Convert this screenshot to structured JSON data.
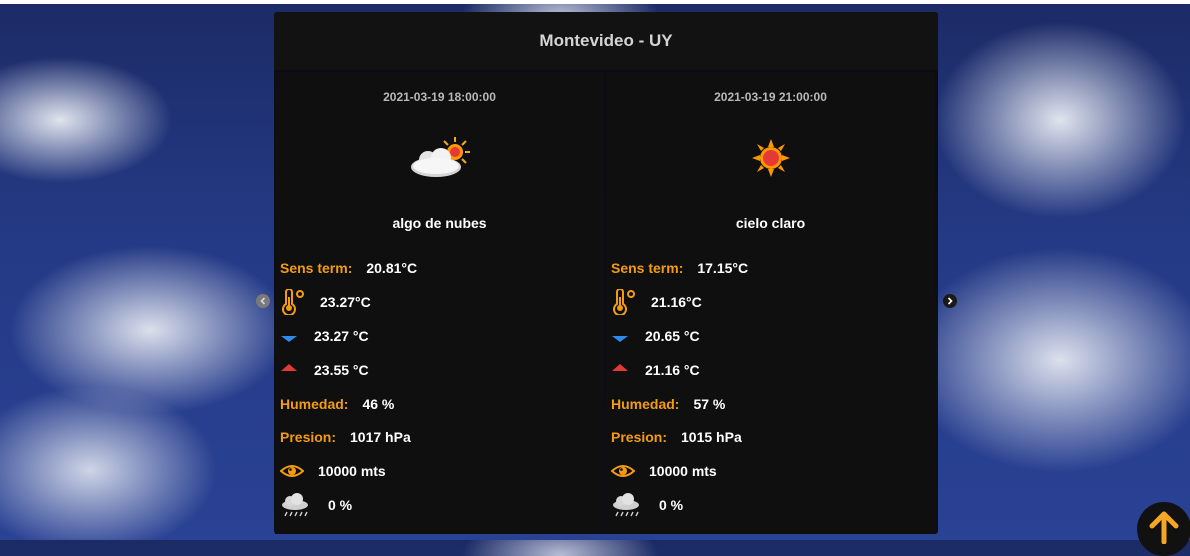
{
  "city": "Montevideo - UY",
  "cards": [
    {
      "datetime": "2021-03-19 18:00:00",
      "icon": "partly-cloudy-icon",
      "description": "algo de nubes",
      "feels_label": "Sens term:",
      "feels_value": "20.81°C",
      "temp": "23.27°C",
      "temp_min": "23.27 °C",
      "temp_max": "23.55 °C",
      "humidity_label": "Humedad:",
      "humidity": "46 %",
      "pressure_label": "Presion:",
      "pressure": "1017 hPa",
      "visibility": "10000 mts",
      "rain_chance": "0 %"
    },
    {
      "datetime": "2021-03-19 21:00:00",
      "icon": "sun-icon",
      "description": "cielo claro",
      "feels_label": "Sens term:",
      "feels_value": "17.15°C",
      "temp": "21.16°C",
      "temp_min": "20.65 °C",
      "temp_max": "21.16 °C",
      "humidity_label": "Humedad:",
      "humidity": "57 %",
      "pressure_label": "Presion:",
      "pressure": "1015 hPa",
      "visibility": "10000 mts",
      "rain_chance": "0 %"
    }
  ],
  "colors": {
    "accent": "#f39c12",
    "min_arrow": "#2e8bea",
    "max_arrow": "#e53935",
    "scroll_arrow": "#f5a623"
  }
}
